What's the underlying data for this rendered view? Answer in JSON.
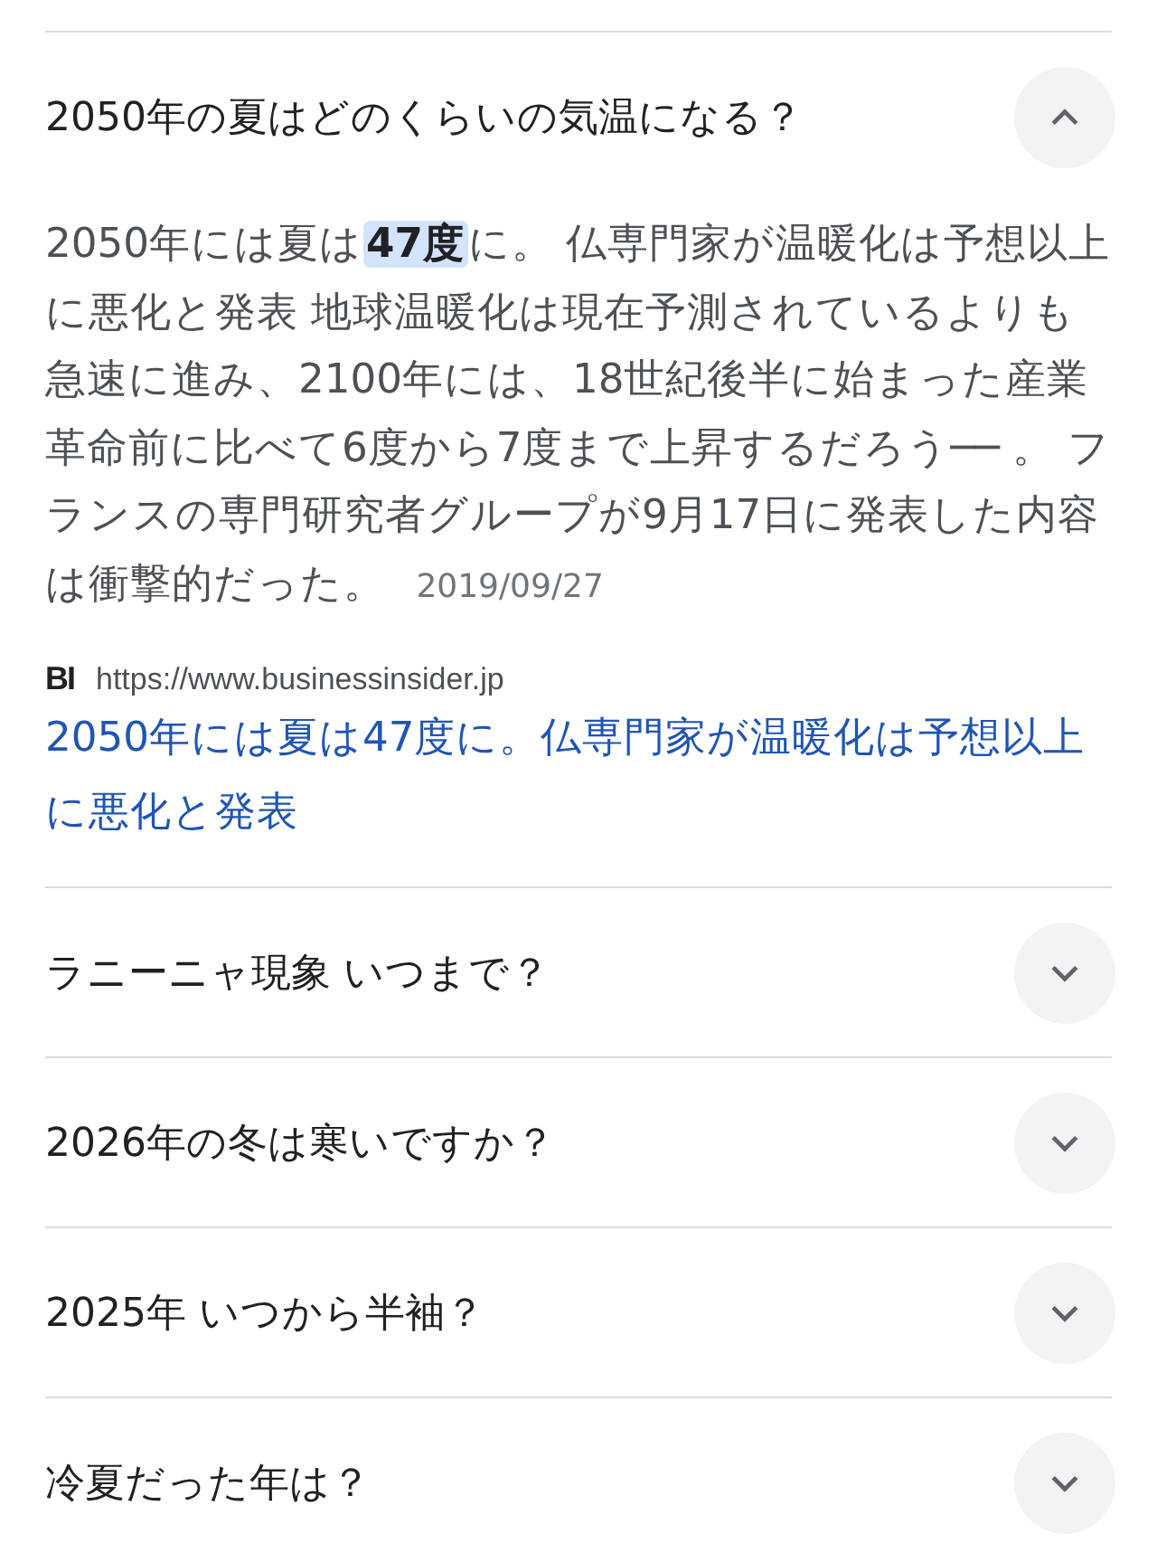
{
  "questions": [
    {
      "question": "2050年の夏はどのくらいの気温になる？",
      "expanded": true,
      "answer": {
        "text": "2050年には夏は**47度**に。 仏専門家が温暖化は予想以上に悪化と発表 地球温暖化は現在予測されているよりも急速に進み、2100年には、18世紀後半に始まった産業革命前に比べて6度から7度まで上昇するだろう── 。 フランスの専門研究者グループが9月17日に発表した内容は衝撃的だった。",
        "date": "2019/09/27",
        "source_logo": "BI",
        "source_url": "https://www.businessinsider.jp",
        "link": "2050年には夏は47度に。仏専門家が温暖化は予想以上に悪化と発表"
      }
    },
    {
      "question": "ラニーニャ現象 いつまで？",
      "expanded": false
    },
    {
      "question": "2026年の冬は寒いですか？",
      "expanded": false
    },
    {
      "question": "2025年 いつから半袖？",
      "expanded": false
    },
    {
      "question": "冷夏だった年は？",
      "expanded": false
    }
  ]
}
